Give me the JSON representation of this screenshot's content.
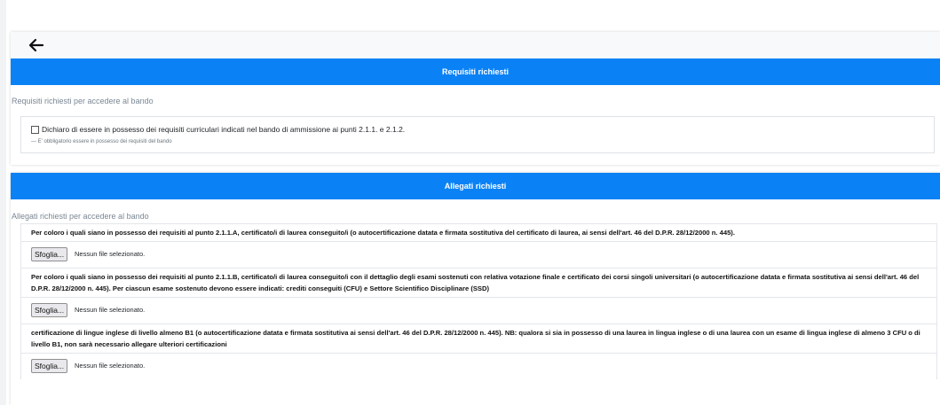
{
  "icons": {
    "back": "arrow-left-icon"
  },
  "colors": {
    "header_bg": "#0a82f5",
    "header_text": "#ffffff"
  },
  "requisiti": {
    "header": "Requisiti richiesti",
    "subtitle": "Requisiti richiesti per accedere al bando",
    "checkbox_label": "Dichiaro di essere in possesso dei requisiti curriculari indicati nel bando di ammissione ai punti 2.1.1. e 2.1.2.",
    "checkbox_help": "— E' obbligatorio essere in possesso dei requisiti del bando",
    "checked": false
  },
  "allegati": {
    "header": "Allegati richiesti",
    "subtitle": "Allegati richiesti per accedere al bando",
    "items": [
      {
        "text": "Per coloro i quali siano in possesso dei requisiti al punto 2.1.1.A, certificato/i di laurea conseguito/i (o autocertificazione datata e firmata sostitutiva del certificato di laurea, ai sensi dell'art. 46 del D.P.R. 28/12/2000 n. 445).",
        "button": "Sfoglia...",
        "status": "Nessun file selezionato."
      },
      {
        "text": "Per coloro i quali siano in possesso dei requisiti al punto 2.1.1.B, certificato/i di laurea conseguito/i con il dettaglio degli esami sostenuti con relativa votazione finale e certificato dei corsi singoli universitari (o autocertificazione datata e firmata sostitutiva ai sensi dell'art. 46 del D.P.R. 28/12/2000 n. 445). Per ciascun esame sostenuto devono essere indicati: crediti conseguiti (CFU) e Settore Scientifico Disciplinare (SSD)",
        "button": "Sfoglia...",
        "status": "Nessun file selezionato."
      },
      {
        "text": "certificazione di lingue inglese di livello almeno B1 (o autocertificazione datata e firmata sostitutiva ai sensi dell'art. 46 del D.P.R. 28/12/2000 n. 445). NB: qualora si sia in possesso di una laurea in lingua inglese o di una laurea con un esame di lingua inglese di almeno 3 CFU o di livello B1, non sarà necessario allegare ulteriori certificazioni",
        "button": "Sfoglia...",
        "status": "Nessun file selezionato."
      }
    ]
  }
}
